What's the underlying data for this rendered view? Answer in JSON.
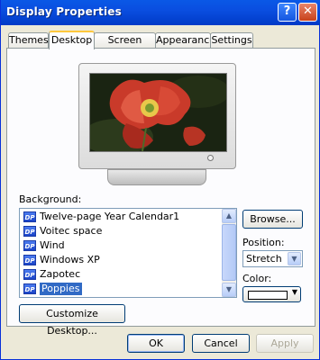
{
  "window": {
    "title": "Display Properties"
  },
  "titlebar": {
    "help": "?",
    "close": "✕"
  },
  "tabs": [
    {
      "label": "Themes"
    },
    {
      "label": "Desktop"
    },
    {
      "label": "Screen Saver"
    },
    {
      "label": "Appearance"
    },
    {
      "label": "Settings"
    }
  ],
  "background": {
    "label": "Background:",
    "items": [
      {
        "label": "Twelve-page Year Calendar1"
      },
      {
        "label": "Voitec space"
      },
      {
        "label": "Wind"
      },
      {
        "label": "Windows XP"
      },
      {
        "label": "Zapotec"
      },
      {
        "label": "Poppies"
      }
    ],
    "selected": "Poppies",
    "item_icon_text": "DP"
  },
  "buttons": {
    "browse": "Browse...",
    "customize": "Customize Desktop...",
    "ok": "OK",
    "cancel": "Cancel",
    "apply": "Apply"
  },
  "position": {
    "label": "Position:",
    "value": "Stretch"
  },
  "color": {
    "label": "Color:",
    "value": "#ffffff"
  },
  "colors": {
    "titlebar": "#0a4ee0",
    "accent_tab": "#ffc83c",
    "selection": "#316ac5"
  }
}
